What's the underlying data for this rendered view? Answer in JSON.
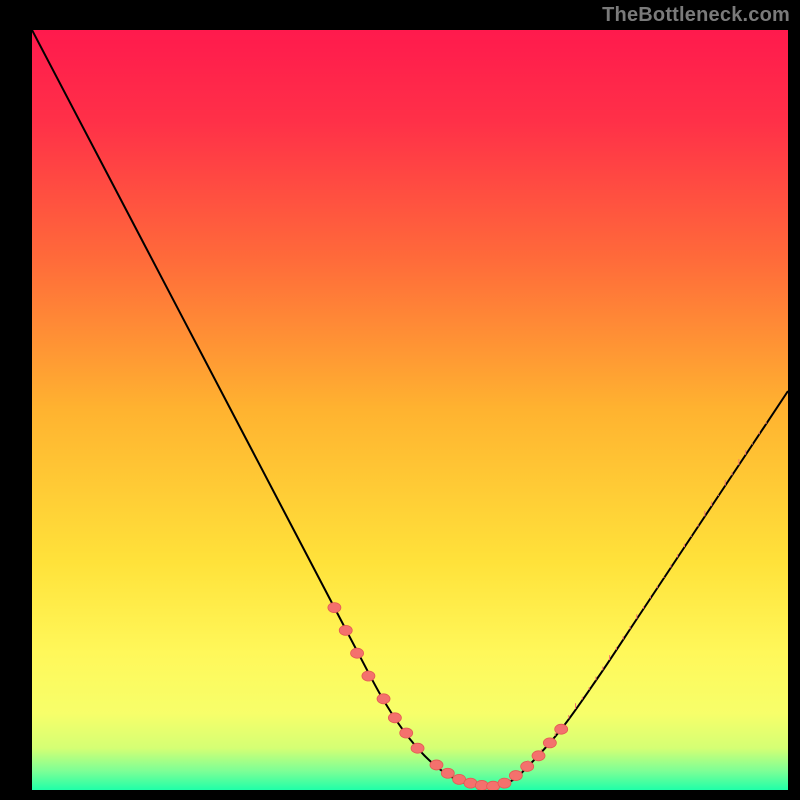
{
  "watermark": "TheBottleneck.com",
  "colors": {
    "page_bg": "#000000",
    "watermark": "#7a7a7a",
    "curve": "#000000",
    "marker_fill": "#f4716d",
    "marker_stroke": "#e45a53",
    "gradient_stops": [
      {
        "offset": 0.0,
        "color": "#ff1a4d"
      },
      {
        "offset": 0.12,
        "color": "#ff3048"
      },
      {
        "offset": 0.3,
        "color": "#ff6a3a"
      },
      {
        "offset": 0.5,
        "color": "#ffb330"
      },
      {
        "offset": 0.7,
        "color": "#ffe23a"
      },
      {
        "offset": 0.82,
        "color": "#fff85a"
      },
      {
        "offset": 0.9,
        "color": "#f7ff6a"
      },
      {
        "offset": 0.945,
        "color": "#d4ff74"
      },
      {
        "offset": 0.975,
        "color": "#7dff96"
      },
      {
        "offset": 1.0,
        "color": "#20ffa8"
      }
    ]
  },
  "chart_data": {
    "type": "line",
    "title": "",
    "xlabel": "",
    "ylabel": "",
    "xlim": [
      0,
      100
    ],
    "ylim": [
      0,
      100
    ],
    "grid": false,
    "legend": false,
    "series": [
      {
        "name": "bottleneck-curve",
        "x": [
          0,
          5,
          10,
          15,
          20,
          25,
          30,
          35,
          40,
          45,
          47,
          49,
          51,
          53,
          55,
          57,
          59,
          61,
          63,
          65,
          70,
          75,
          80,
          85,
          90,
          95,
          100
        ],
        "y": [
          100,
          90.5,
          81,
          71.5,
          62,
          52.5,
          43,
          33.5,
          24,
          14.5,
          11,
          8,
          5.5,
          3.5,
          2,
          1,
          0.5,
          0.5,
          1,
          2.5,
          8,
          15,
          22.5,
          30,
          37.5,
          45,
          52.5
        ]
      }
    ],
    "markers": {
      "name": "highlight-points",
      "x": [
        40,
        41.5,
        43,
        44.5,
        46.5,
        48,
        49.5,
        51,
        53.5,
        55,
        56.5,
        58,
        59.5,
        61,
        62.5,
        64,
        65.5,
        67,
        68.5,
        70
      ],
      "y": [
        24,
        21,
        18,
        15,
        12,
        9.5,
        7.5,
        5.5,
        3.3,
        2.2,
        1.4,
        0.9,
        0.6,
        0.5,
        0.9,
        1.9,
        3.1,
        4.5,
        6.2,
        8
      ]
    }
  }
}
